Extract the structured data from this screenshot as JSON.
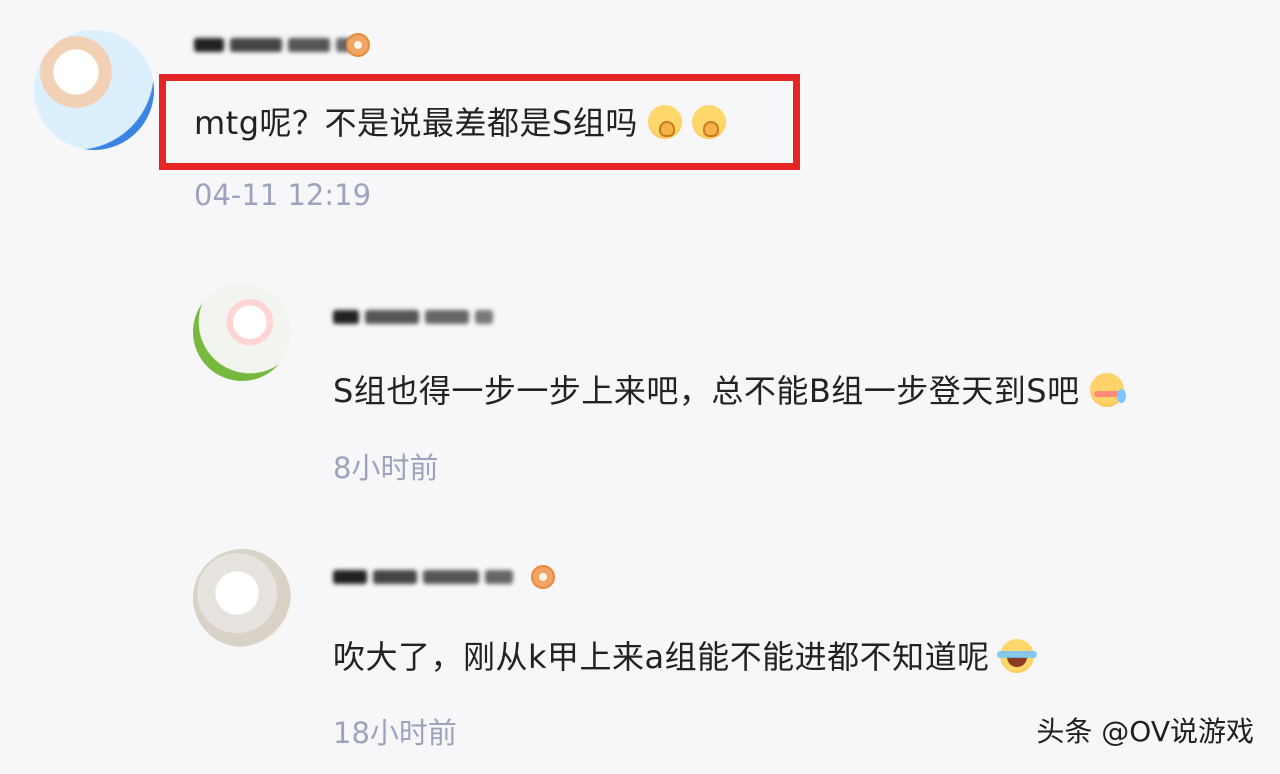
{
  "comments": [
    {
      "text": "mtg呢？不是说最差都是S组吗",
      "time": "04-11 12:19",
      "emoji_1": "hush-emoji-icon",
      "emoji_2": "hush-emoji-icon"
    },
    {
      "text": "S组也得一步一步上来吧，总不能B组一步登天到S吧",
      "time": "8小时前",
      "emoji_1": "blush-sweat-emoji-icon"
    },
    {
      "text": "吹大了，刚从k甲上来a组能不能进都不知道呢",
      "time": "18小时前",
      "emoji_1": "tears-of-joy-emoji-icon"
    }
  ],
  "watermark": "头条 @OV说游戏",
  "colors": {
    "background": "#f7f7f9",
    "time_text": "#9ea3bd",
    "highlight_box": "#e52525",
    "badge": "#f0a565"
  }
}
